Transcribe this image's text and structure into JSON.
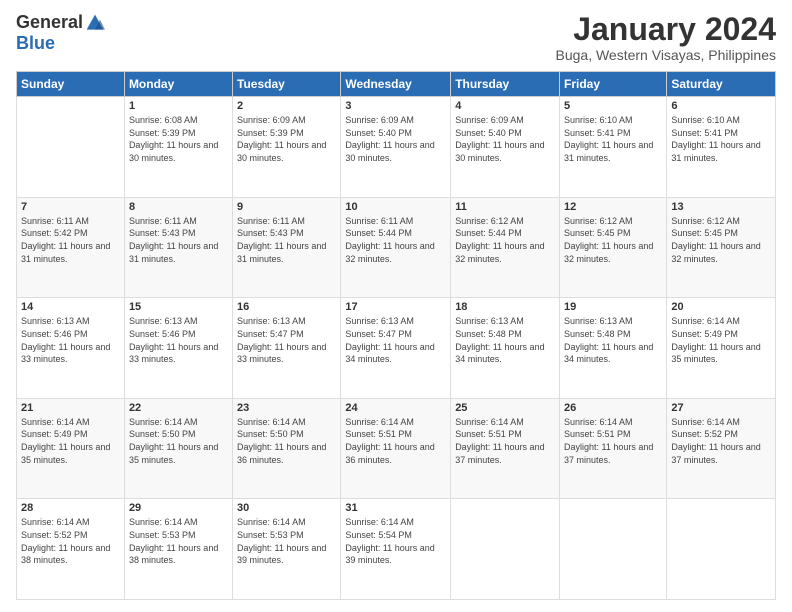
{
  "logo": {
    "general": "General",
    "blue": "Blue"
  },
  "title": "January 2024",
  "subtitle": "Buga, Western Visayas, Philippines",
  "headers": [
    "Sunday",
    "Monday",
    "Tuesday",
    "Wednesday",
    "Thursday",
    "Friday",
    "Saturday"
  ],
  "weeks": [
    [
      {
        "day": "",
        "sunrise": "",
        "sunset": "",
        "daylight": ""
      },
      {
        "day": "1",
        "sunrise": "Sunrise: 6:08 AM",
        "sunset": "Sunset: 5:39 PM",
        "daylight": "Daylight: 11 hours and 30 minutes."
      },
      {
        "day": "2",
        "sunrise": "Sunrise: 6:09 AM",
        "sunset": "Sunset: 5:39 PM",
        "daylight": "Daylight: 11 hours and 30 minutes."
      },
      {
        "day": "3",
        "sunrise": "Sunrise: 6:09 AM",
        "sunset": "Sunset: 5:40 PM",
        "daylight": "Daylight: 11 hours and 30 minutes."
      },
      {
        "day": "4",
        "sunrise": "Sunrise: 6:09 AM",
        "sunset": "Sunset: 5:40 PM",
        "daylight": "Daylight: 11 hours and 30 minutes."
      },
      {
        "day": "5",
        "sunrise": "Sunrise: 6:10 AM",
        "sunset": "Sunset: 5:41 PM",
        "daylight": "Daylight: 11 hours and 31 minutes."
      },
      {
        "day": "6",
        "sunrise": "Sunrise: 6:10 AM",
        "sunset": "Sunset: 5:41 PM",
        "daylight": "Daylight: 11 hours and 31 minutes."
      }
    ],
    [
      {
        "day": "7",
        "sunrise": "Sunrise: 6:11 AM",
        "sunset": "Sunset: 5:42 PM",
        "daylight": "Daylight: 11 hours and 31 minutes."
      },
      {
        "day": "8",
        "sunrise": "Sunrise: 6:11 AM",
        "sunset": "Sunset: 5:43 PM",
        "daylight": "Daylight: 11 hours and 31 minutes."
      },
      {
        "day": "9",
        "sunrise": "Sunrise: 6:11 AM",
        "sunset": "Sunset: 5:43 PM",
        "daylight": "Daylight: 11 hours and 31 minutes."
      },
      {
        "day": "10",
        "sunrise": "Sunrise: 6:11 AM",
        "sunset": "Sunset: 5:44 PM",
        "daylight": "Daylight: 11 hours and 32 minutes."
      },
      {
        "day": "11",
        "sunrise": "Sunrise: 6:12 AM",
        "sunset": "Sunset: 5:44 PM",
        "daylight": "Daylight: 11 hours and 32 minutes."
      },
      {
        "day": "12",
        "sunrise": "Sunrise: 6:12 AM",
        "sunset": "Sunset: 5:45 PM",
        "daylight": "Daylight: 11 hours and 32 minutes."
      },
      {
        "day": "13",
        "sunrise": "Sunrise: 6:12 AM",
        "sunset": "Sunset: 5:45 PM",
        "daylight": "Daylight: 11 hours and 32 minutes."
      }
    ],
    [
      {
        "day": "14",
        "sunrise": "Sunrise: 6:13 AM",
        "sunset": "Sunset: 5:46 PM",
        "daylight": "Daylight: 11 hours and 33 minutes."
      },
      {
        "day": "15",
        "sunrise": "Sunrise: 6:13 AM",
        "sunset": "Sunset: 5:46 PM",
        "daylight": "Daylight: 11 hours and 33 minutes."
      },
      {
        "day": "16",
        "sunrise": "Sunrise: 6:13 AM",
        "sunset": "Sunset: 5:47 PM",
        "daylight": "Daylight: 11 hours and 33 minutes."
      },
      {
        "day": "17",
        "sunrise": "Sunrise: 6:13 AM",
        "sunset": "Sunset: 5:47 PM",
        "daylight": "Daylight: 11 hours and 34 minutes."
      },
      {
        "day": "18",
        "sunrise": "Sunrise: 6:13 AM",
        "sunset": "Sunset: 5:48 PM",
        "daylight": "Daylight: 11 hours and 34 minutes."
      },
      {
        "day": "19",
        "sunrise": "Sunrise: 6:13 AM",
        "sunset": "Sunset: 5:48 PM",
        "daylight": "Daylight: 11 hours and 34 minutes."
      },
      {
        "day": "20",
        "sunrise": "Sunrise: 6:14 AM",
        "sunset": "Sunset: 5:49 PM",
        "daylight": "Daylight: 11 hours and 35 minutes."
      }
    ],
    [
      {
        "day": "21",
        "sunrise": "Sunrise: 6:14 AM",
        "sunset": "Sunset: 5:49 PM",
        "daylight": "Daylight: 11 hours and 35 minutes."
      },
      {
        "day": "22",
        "sunrise": "Sunrise: 6:14 AM",
        "sunset": "Sunset: 5:50 PM",
        "daylight": "Daylight: 11 hours and 35 minutes."
      },
      {
        "day": "23",
        "sunrise": "Sunrise: 6:14 AM",
        "sunset": "Sunset: 5:50 PM",
        "daylight": "Daylight: 11 hours and 36 minutes."
      },
      {
        "day": "24",
        "sunrise": "Sunrise: 6:14 AM",
        "sunset": "Sunset: 5:51 PM",
        "daylight": "Daylight: 11 hours and 36 minutes."
      },
      {
        "day": "25",
        "sunrise": "Sunrise: 6:14 AM",
        "sunset": "Sunset: 5:51 PM",
        "daylight": "Daylight: 11 hours and 37 minutes."
      },
      {
        "day": "26",
        "sunrise": "Sunrise: 6:14 AM",
        "sunset": "Sunset: 5:51 PM",
        "daylight": "Daylight: 11 hours and 37 minutes."
      },
      {
        "day": "27",
        "sunrise": "Sunrise: 6:14 AM",
        "sunset": "Sunset: 5:52 PM",
        "daylight": "Daylight: 11 hours and 37 minutes."
      }
    ],
    [
      {
        "day": "28",
        "sunrise": "Sunrise: 6:14 AM",
        "sunset": "Sunset: 5:52 PM",
        "daylight": "Daylight: 11 hours and 38 minutes."
      },
      {
        "day": "29",
        "sunrise": "Sunrise: 6:14 AM",
        "sunset": "Sunset: 5:53 PM",
        "daylight": "Daylight: 11 hours and 38 minutes."
      },
      {
        "day": "30",
        "sunrise": "Sunrise: 6:14 AM",
        "sunset": "Sunset: 5:53 PM",
        "daylight": "Daylight: 11 hours and 39 minutes."
      },
      {
        "day": "31",
        "sunrise": "Sunrise: 6:14 AM",
        "sunset": "Sunset: 5:54 PM",
        "daylight": "Daylight: 11 hours and 39 minutes."
      },
      {
        "day": "",
        "sunrise": "",
        "sunset": "",
        "daylight": ""
      },
      {
        "day": "",
        "sunrise": "",
        "sunset": "",
        "daylight": ""
      },
      {
        "day": "",
        "sunrise": "",
        "sunset": "",
        "daylight": ""
      }
    ]
  ]
}
